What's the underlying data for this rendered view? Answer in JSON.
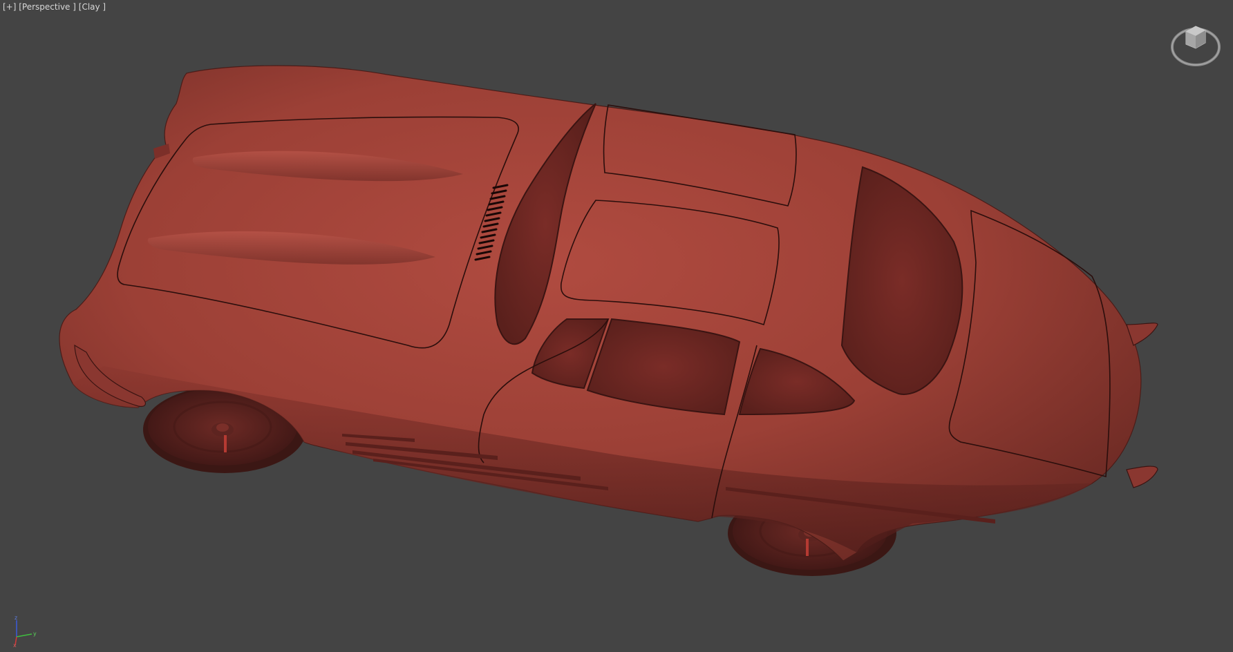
{
  "viewport": {
    "menu_label": "[+]",
    "view_label": "[Perspective ]",
    "shading_label": "[Clay ]"
  },
  "axis": {
    "z_label": "z",
    "y_label": "y",
    "x_label": "x"
  },
  "colors": {
    "background": "#444444",
    "clay": "#a9463c",
    "clay_dark": "#5e2320",
    "label_text": "#d8d8d8"
  },
  "icons": {
    "viewcube": "viewcube-icon",
    "axis": "axis-tripod-icon"
  }
}
